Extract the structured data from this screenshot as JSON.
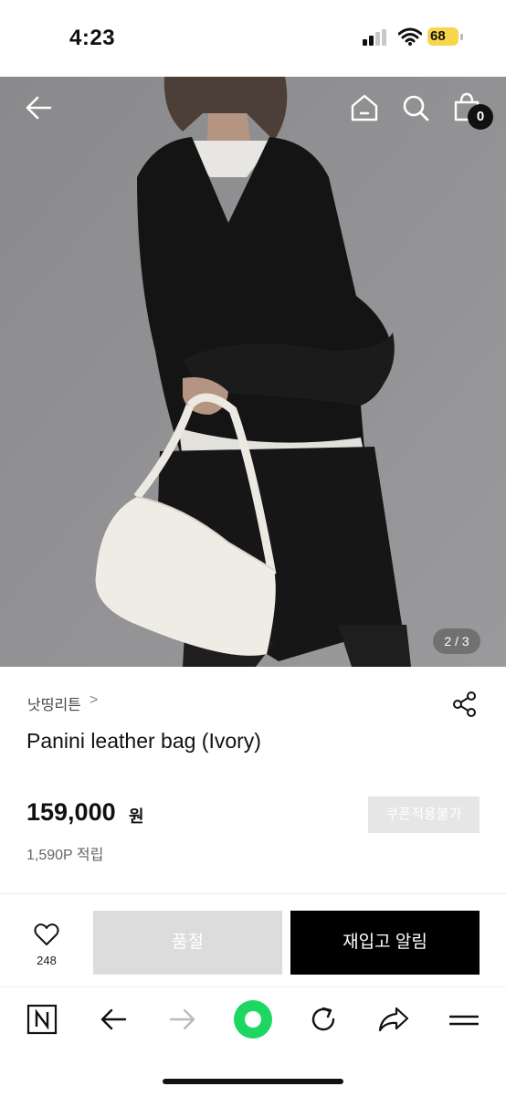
{
  "status_bar": {
    "time": "4:23",
    "battery": "68"
  },
  "header": {
    "cart_count": "0"
  },
  "gallery": {
    "counter": "2 / 3"
  },
  "product": {
    "brand": "낫띵리튼",
    "brand_chevron": ">",
    "name": "Panini leather bag (Ivory)",
    "price": "159,000",
    "currency": "원",
    "points": "1,590P 적립",
    "coupon_label": "쿠폰적용불가"
  },
  "actions": {
    "like_count": "248",
    "soldout_label": "품절",
    "restock_label": "재입고 알림"
  },
  "colors": {
    "accent_green": "#1ed760",
    "black": "#000000",
    "disabled_gray": "#dcdcdc",
    "battery_yellow": "#f7d64a"
  },
  "icons": [
    "back-arrow-icon",
    "home-icon",
    "search-icon",
    "shopping-bag-icon",
    "share-icon",
    "heart-icon",
    "naver-n-icon",
    "browser-back-icon",
    "browser-forward-icon",
    "green-dot-icon",
    "refresh-icon",
    "share-arrow-icon",
    "menu-icon"
  ]
}
